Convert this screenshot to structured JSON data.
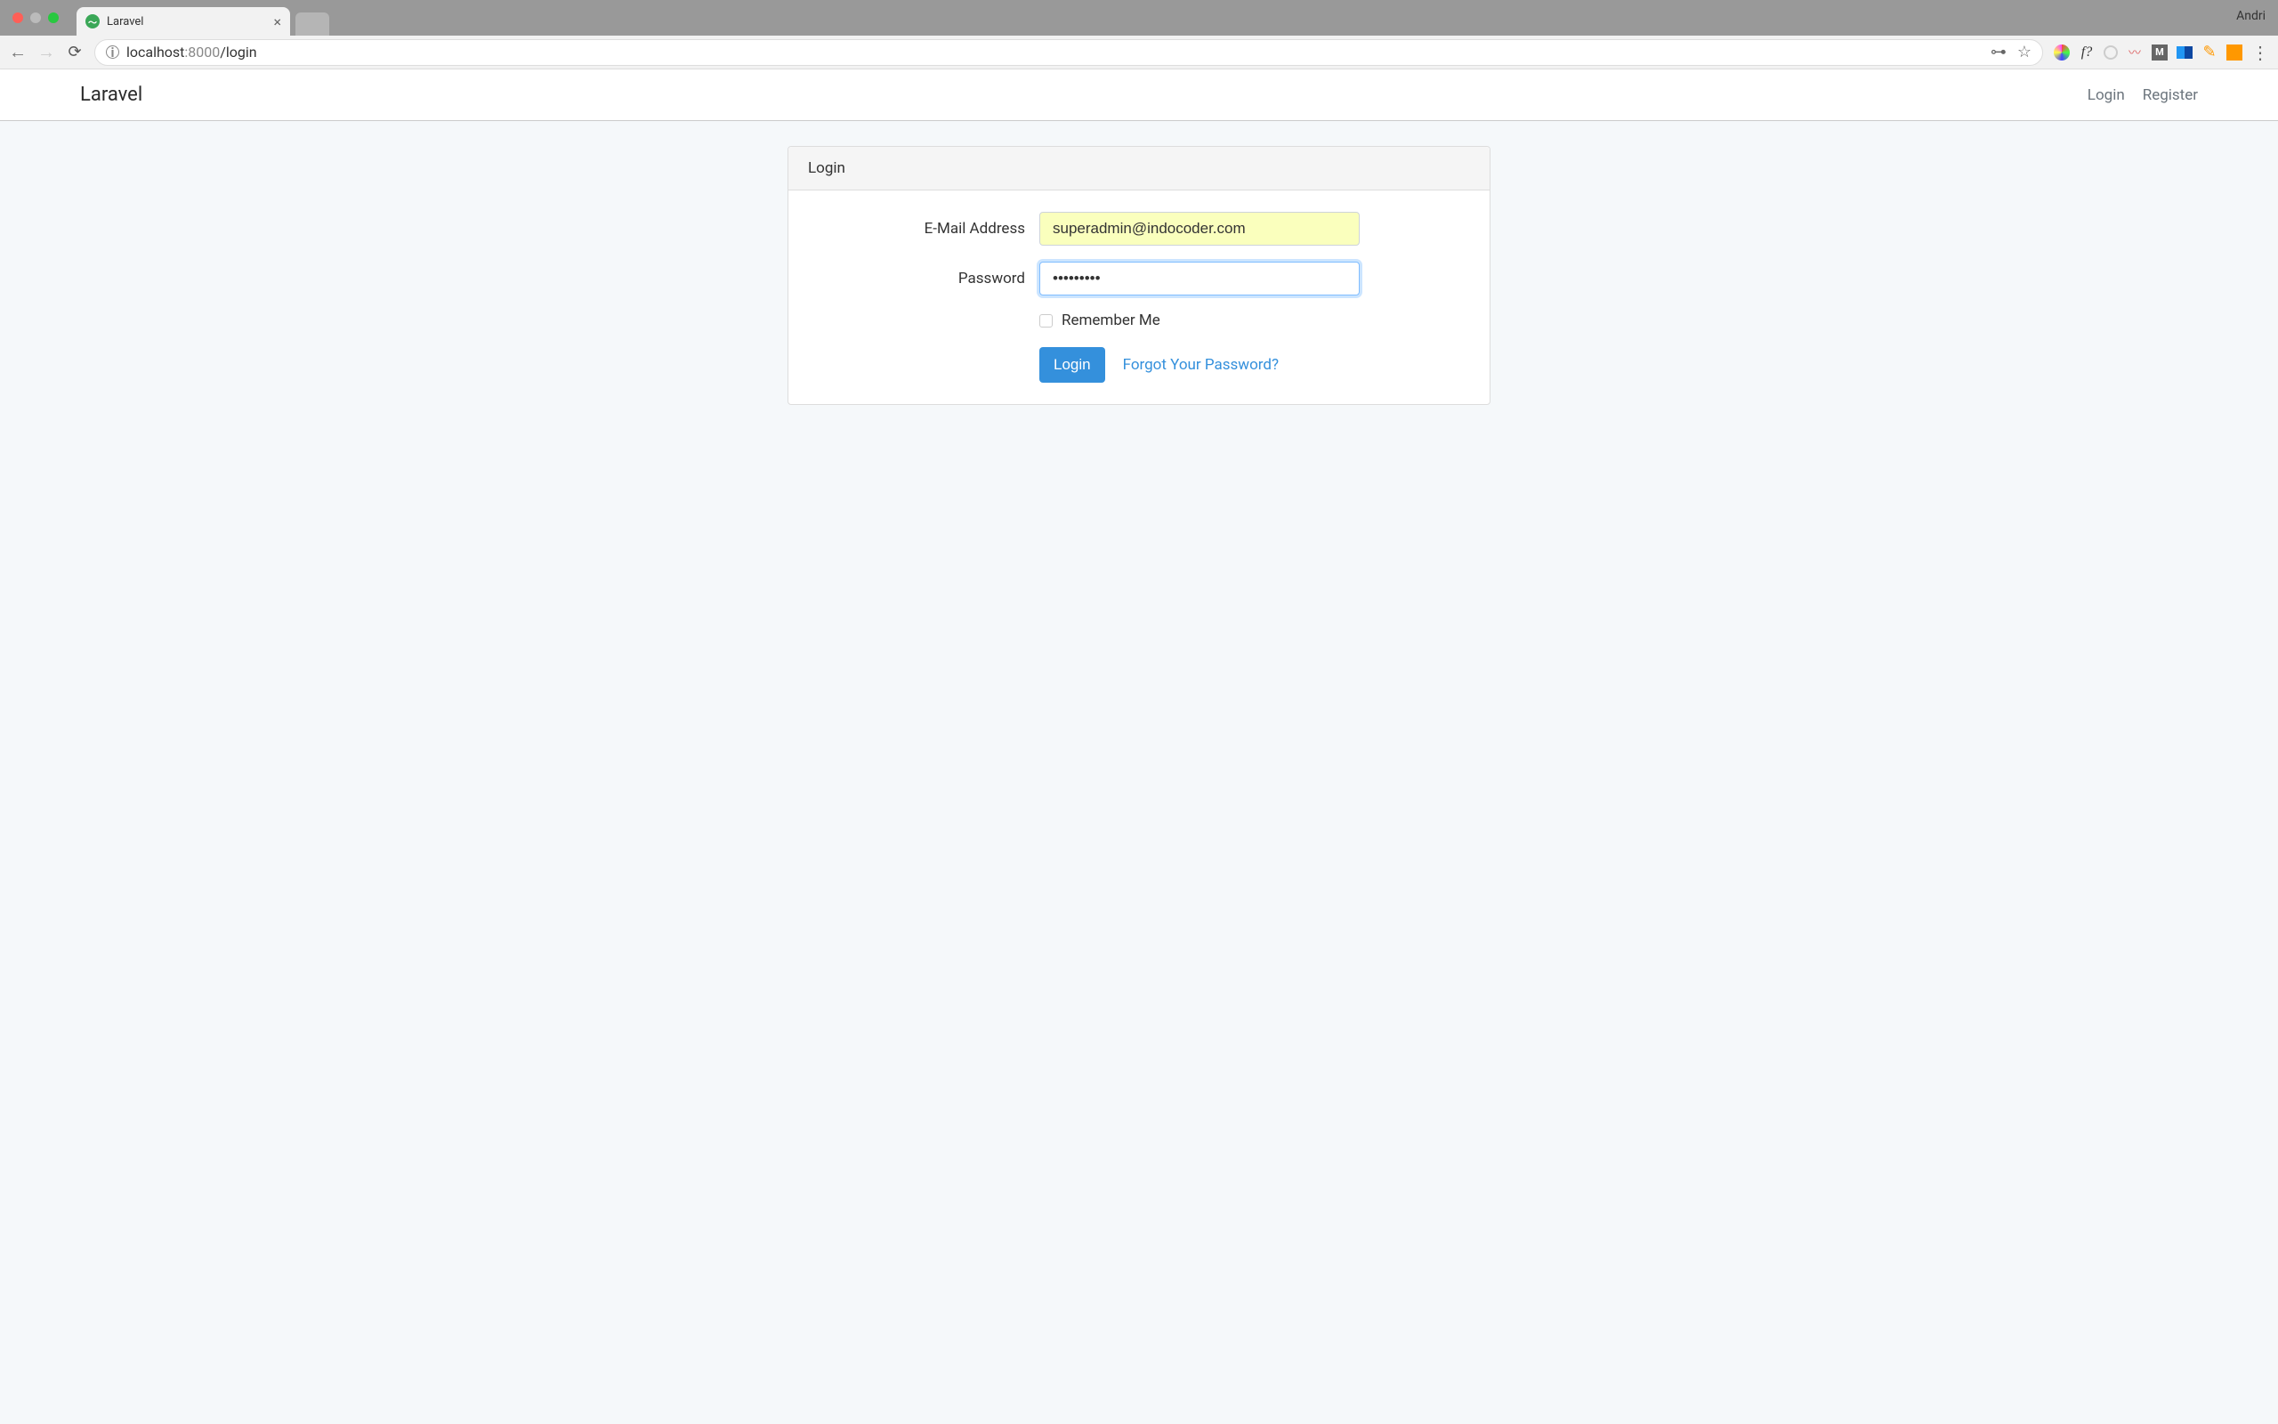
{
  "chrome": {
    "profile_name": "Andri",
    "tab_title": "Laravel",
    "url_host": "localhost",
    "url_port": ":8000",
    "url_path": "/login"
  },
  "navbar": {
    "brand": "Laravel",
    "login_link": "Login",
    "register_link": "Register"
  },
  "card": {
    "header": "Login",
    "email_label": "E-Mail Address",
    "email_value": "superadmin@indocoder.com",
    "password_label": "Password",
    "password_value": "•••••••••",
    "remember_label": "Remember Me",
    "login_button": "Login",
    "forgot_link": "Forgot Your Password?"
  }
}
